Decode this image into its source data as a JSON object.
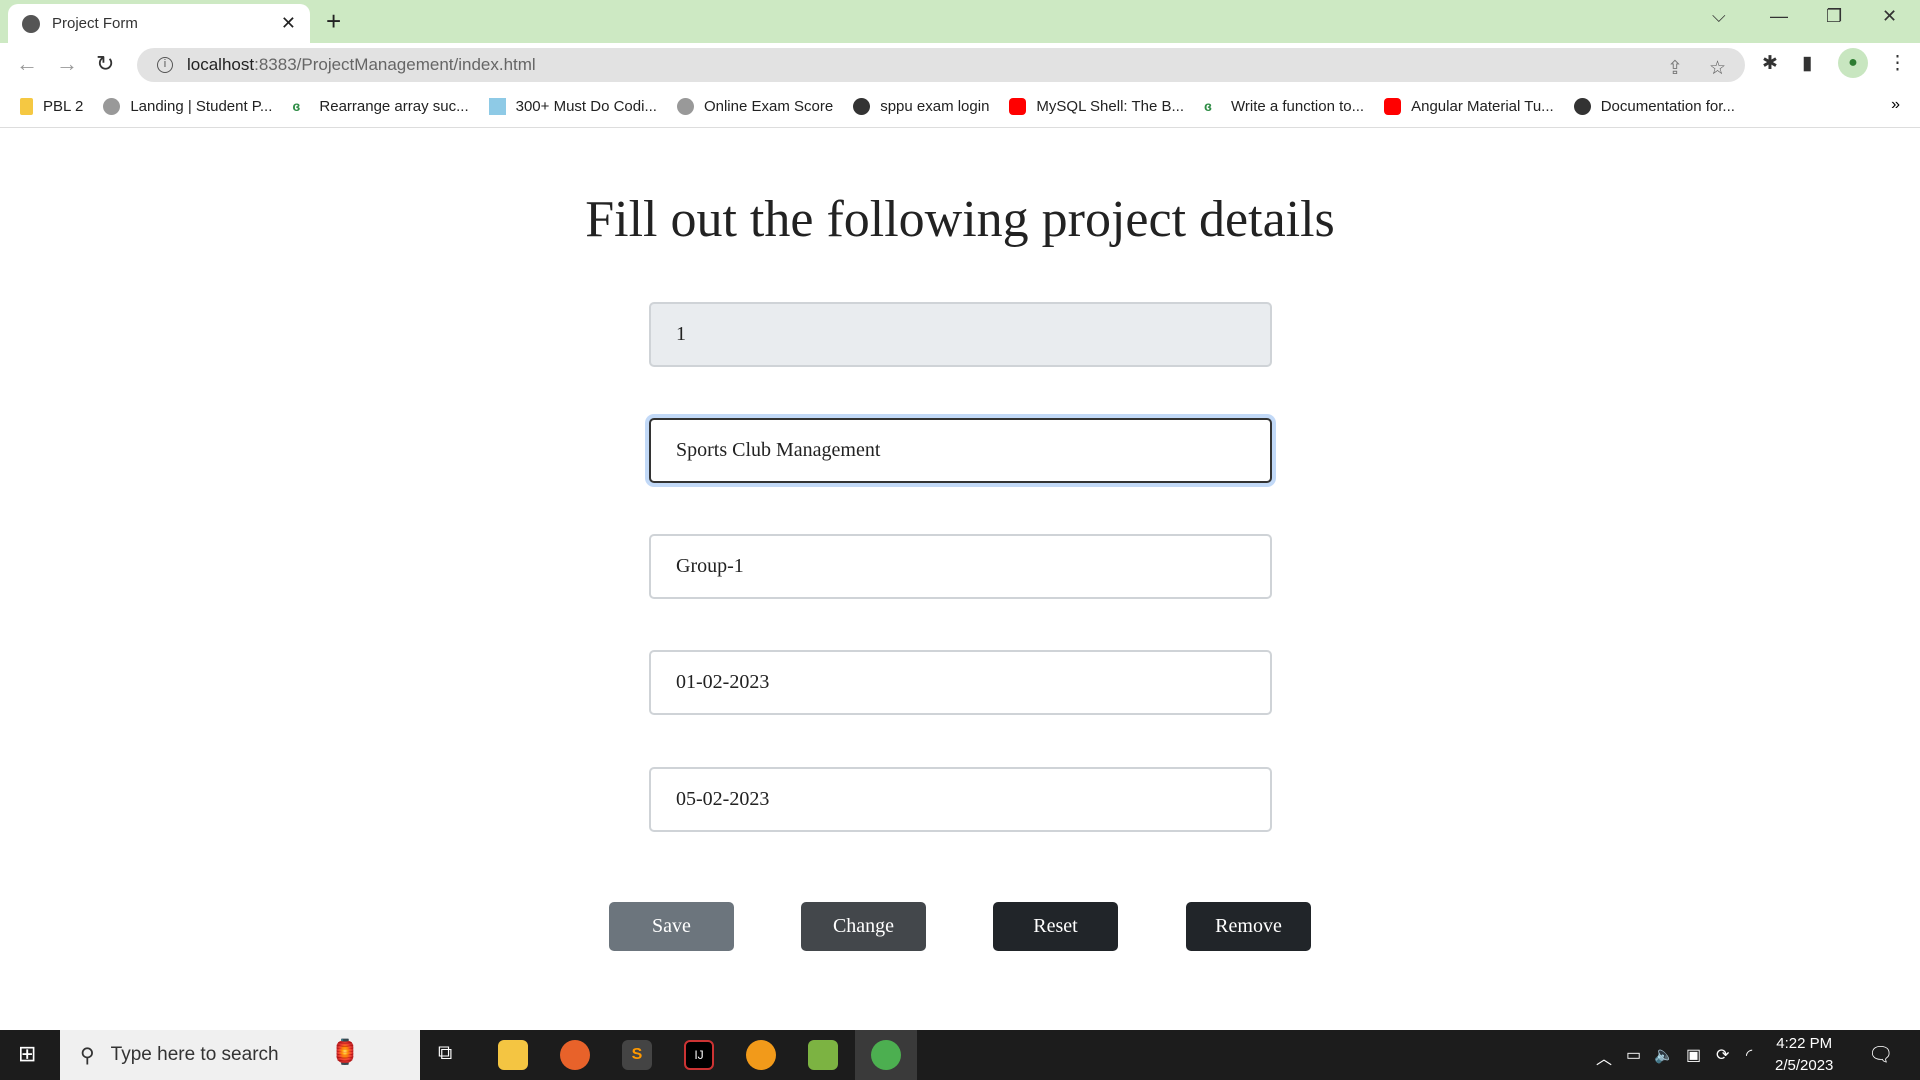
{
  "browser": {
    "tab_title": "Project Form",
    "url_host": "localhost",
    "url_path": ":8383/ProjectManagement/index.html",
    "bookmarks": [
      "PBL 2",
      "Landing | Student P...",
      "Rearrange array suc...",
      "300+ Must Do Codi...",
      "Online Exam Score",
      "sppu exam login",
      "MySQL Shell: The B...",
      "Write a function to...",
      "Angular Material Tu...",
      "Documentation for..."
    ]
  },
  "page": {
    "title": "Fill out the following project details",
    "fields": [
      "1",
      "Sports Club Management",
      "Group-1",
      "01-02-2023",
      "05-02-2023"
    ],
    "buttons": {
      "save": "Save",
      "change": "Change",
      "reset": "Reset",
      "remove": "Remove"
    },
    "colors": {
      "save": "#6c757d",
      "change": "#43474b",
      "reset": "#212529",
      "remove": "#212529"
    }
  },
  "taskbar": {
    "search_placeholder": "Type here to search",
    "time": "4:22 PM",
    "date": "2/5/2023"
  }
}
